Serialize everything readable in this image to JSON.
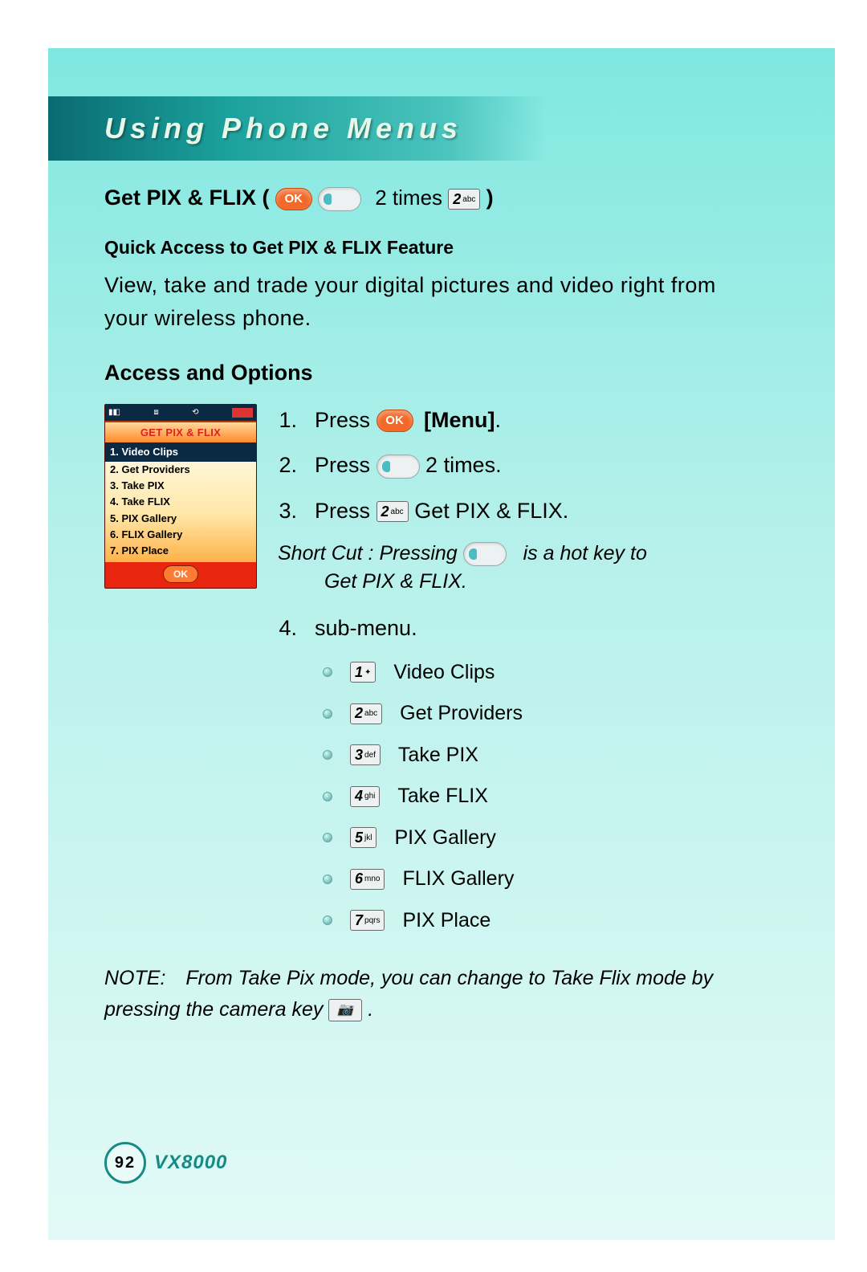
{
  "title": "Using Phone Menus",
  "header": {
    "label": "Get PIX & FLIX (",
    "ok": "OK",
    "mid": "2 times",
    "key2": {
      "digit": "2",
      "letters": "abc"
    },
    "close": ")"
  },
  "quick_access_heading": "Quick Access to Get PIX & FLIX Feature",
  "description": "View, take and trade your digital pictures and video right from your wireless phone.",
  "access_heading": "Access and Options",
  "phone": {
    "title": "GET PIX & FLIX",
    "items": [
      "1.  Video Clips",
      "2.  Get Providers",
      "3.  Take PIX",
      "4.  Take FLIX",
      "5.  PIX Gallery",
      "6.  FLIX Gallery",
      "7.  PIX Place"
    ],
    "ok": "OK"
  },
  "steps": [
    {
      "n": "1.",
      "pre": "Press ",
      "icon": "ok",
      "post_bold": "[Menu]",
      "post": "."
    },
    {
      "n": "2.",
      "pre": "Press ",
      "icon": "nav",
      "post": " 2 times."
    },
    {
      "n": "3.",
      "pre": "Press  ",
      "icon": "key2",
      "post": "  Get PIX & FLIX."
    }
  ],
  "shortcut": {
    "pre": "Short Cut : Pressing ",
    "post": " is a hot key to",
    "line2": "Get PIX & FLIX."
  },
  "step4": {
    "n": "4.",
    "text": "sub-menu."
  },
  "submenu": [
    {
      "key": {
        "digit": "1",
        "letters": " "
      },
      "label": "Video Clips"
    },
    {
      "key": {
        "digit": "2",
        "letters": "abc"
      },
      "label": "Get Providers"
    },
    {
      "key": {
        "digit": "3",
        "letters": "def"
      },
      "label": "Take PIX"
    },
    {
      "key": {
        "digit": "4",
        "letters": "ghi"
      },
      "label": "Take FLIX"
    },
    {
      "key": {
        "digit": "5",
        "letters": "jkl"
      },
      "label": "PIX Gallery"
    },
    {
      "key": {
        "digit": "6",
        "letters": "mno"
      },
      "label": "FLIX Gallery"
    },
    {
      "key": {
        "digit": "7",
        "letters": "pqrs"
      },
      "label": "PIX Place"
    }
  ],
  "note": {
    "label": "NOTE:",
    "pre": "From Take Pix mode, you can change to Take Flix mode by pressing the camera key ",
    "post": "."
  },
  "footer": {
    "page": "92",
    "model": "VX8000"
  }
}
